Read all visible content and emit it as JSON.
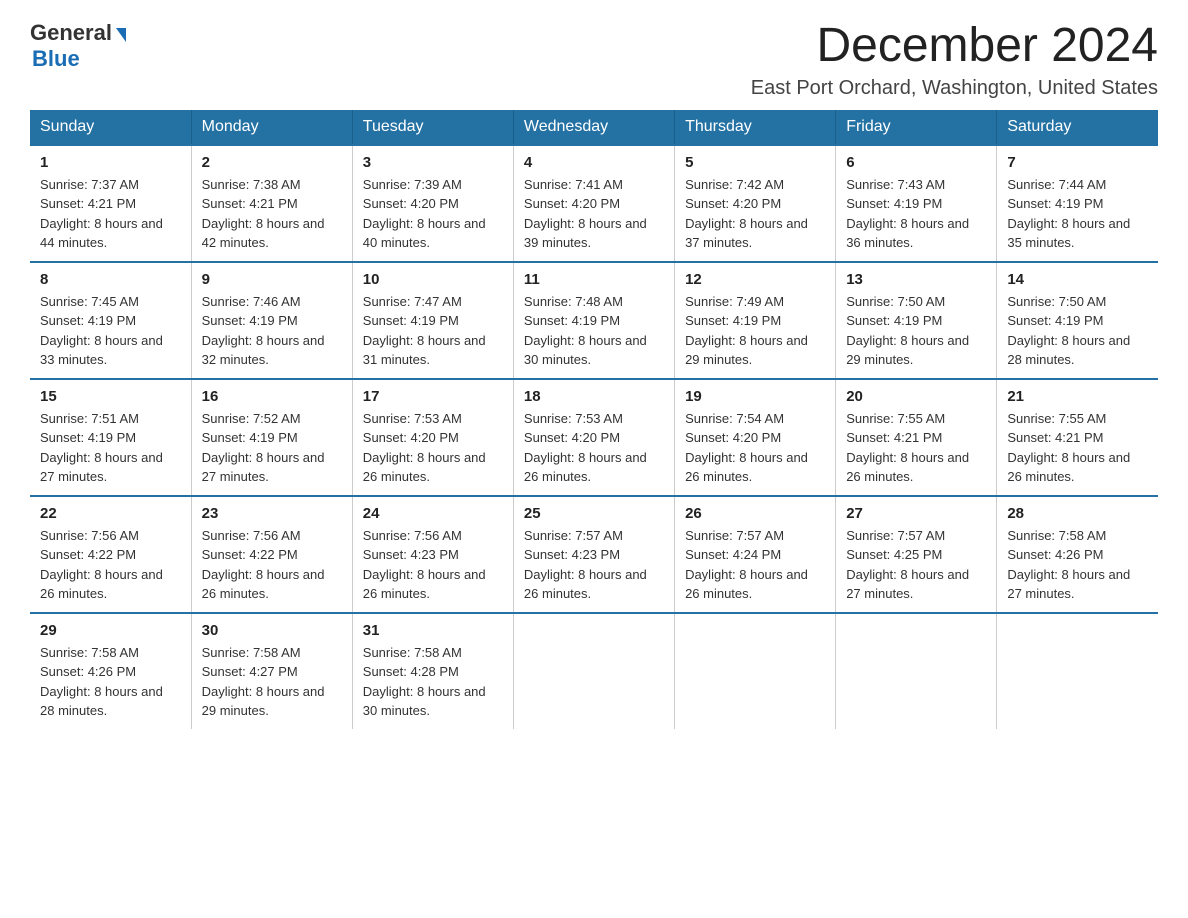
{
  "header": {
    "logo_general": "General",
    "logo_blue": "Blue",
    "month_title": "December 2024",
    "location": "East Port Orchard, Washington, United States"
  },
  "weekdays": [
    "Sunday",
    "Monday",
    "Tuesday",
    "Wednesday",
    "Thursday",
    "Friday",
    "Saturday"
  ],
  "weeks": [
    [
      {
        "day": "1",
        "sunrise": "7:37 AM",
        "sunset": "4:21 PM",
        "daylight": "8 hours and 44 minutes."
      },
      {
        "day": "2",
        "sunrise": "7:38 AM",
        "sunset": "4:21 PM",
        "daylight": "8 hours and 42 minutes."
      },
      {
        "day": "3",
        "sunrise": "7:39 AM",
        "sunset": "4:20 PM",
        "daylight": "8 hours and 40 minutes."
      },
      {
        "day": "4",
        "sunrise": "7:41 AM",
        "sunset": "4:20 PM",
        "daylight": "8 hours and 39 minutes."
      },
      {
        "day": "5",
        "sunrise": "7:42 AM",
        "sunset": "4:20 PM",
        "daylight": "8 hours and 37 minutes."
      },
      {
        "day": "6",
        "sunrise": "7:43 AM",
        "sunset": "4:19 PM",
        "daylight": "8 hours and 36 minutes."
      },
      {
        "day": "7",
        "sunrise": "7:44 AM",
        "sunset": "4:19 PM",
        "daylight": "8 hours and 35 minutes."
      }
    ],
    [
      {
        "day": "8",
        "sunrise": "7:45 AM",
        "sunset": "4:19 PM",
        "daylight": "8 hours and 33 minutes."
      },
      {
        "day": "9",
        "sunrise": "7:46 AM",
        "sunset": "4:19 PM",
        "daylight": "8 hours and 32 minutes."
      },
      {
        "day": "10",
        "sunrise": "7:47 AM",
        "sunset": "4:19 PM",
        "daylight": "8 hours and 31 minutes."
      },
      {
        "day": "11",
        "sunrise": "7:48 AM",
        "sunset": "4:19 PM",
        "daylight": "8 hours and 30 minutes."
      },
      {
        "day": "12",
        "sunrise": "7:49 AM",
        "sunset": "4:19 PM",
        "daylight": "8 hours and 29 minutes."
      },
      {
        "day": "13",
        "sunrise": "7:50 AM",
        "sunset": "4:19 PM",
        "daylight": "8 hours and 29 minutes."
      },
      {
        "day": "14",
        "sunrise": "7:50 AM",
        "sunset": "4:19 PM",
        "daylight": "8 hours and 28 minutes."
      }
    ],
    [
      {
        "day": "15",
        "sunrise": "7:51 AM",
        "sunset": "4:19 PM",
        "daylight": "8 hours and 27 minutes."
      },
      {
        "day": "16",
        "sunrise": "7:52 AM",
        "sunset": "4:19 PM",
        "daylight": "8 hours and 27 minutes."
      },
      {
        "day": "17",
        "sunrise": "7:53 AM",
        "sunset": "4:20 PM",
        "daylight": "8 hours and 26 minutes."
      },
      {
        "day": "18",
        "sunrise": "7:53 AM",
        "sunset": "4:20 PM",
        "daylight": "8 hours and 26 minutes."
      },
      {
        "day": "19",
        "sunrise": "7:54 AM",
        "sunset": "4:20 PM",
        "daylight": "8 hours and 26 minutes."
      },
      {
        "day": "20",
        "sunrise": "7:55 AM",
        "sunset": "4:21 PM",
        "daylight": "8 hours and 26 minutes."
      },
      {
        "day": "21",
        "sunrise": "7:55 AM",
        "sunset": "4:21 PM",
        "daylight": "8 hours and 26 minutes."
      }
    ],
    [
      {
        "day": "22",
        "sunrise": "7:56 AM",
        "sunset": "4:22 PM",
        "daylight": "8 hours and 26 minutes."
      },
      {
        "day": "23",
        "sunrise": "7:56 AM",
        "sunset": "4:22 PM",
        "daylight": "8 hours and 26 minutes."
      },
      {
        "day": "24",
        "sunrise": "7:56 AM",
        "sunset": "4:23 PM",
        "daylight": "8 hours and 26 minutes."
      },
      {
        "day": "25",
        "sunrise": "7:57 AM",
        "sunset": "4:23 PM",
        "daylight": "8 hours and 26 minutes."
      },
      {
        "day": "26",
        "sunrise": "7:57 AM",
        "sunset": "4:24 PM",
        "daylight": "8 hours and 26 minutes."
      },
      {
        "day": "27",
        "sunrise": "7:57 AM",
        "sunset": "4:25 PM",
        "daylight": "8 hours and 27 minutes."
      },
      {
        "day": "28",
        "sunrise": "7:58 AM",
        "sunset": "4:26 PM",
        "daylight": "8 hours and 27 minutes."
      }
    ],
    [
      {
        "day": "29",
        "sunrise": "7:58 AM",
        "sunset": "4:26 PM",
        "daylight": "8 hours and 28 minutes."
      },
      {
        "day": "30",
        "sunrise": "7:58 AM",
        "sunset": "4:27 PM",
        "daylight": "8 hours and 29 minutes."
      },
      {
        "day": "31",
        "sunrise": "7:58 AM",
        "sunset": "4:28 PM",
        "daylight": "8 hours and 30 minutes."
      },
      null,
      null,
      null,
      null
    ]
  ]
}
